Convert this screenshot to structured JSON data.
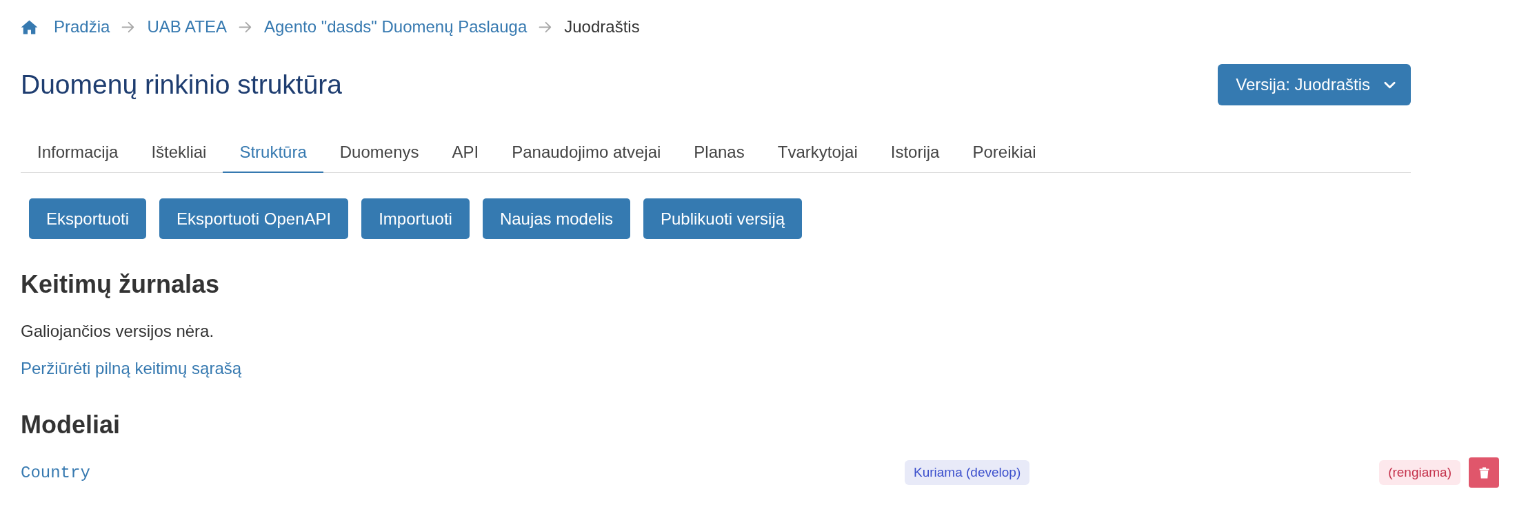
{
  "breadcrumb": [
    {
      "label": "Pradžia",
      "kind": "home"
    },
    {
      "label": "UAB ATEA",
      "kind": "link"
    },
    {
      "label": "Agento \"dasds\" Duomenų Paslauga",
      "kind": "link"
    },
    {
      "label": "Juodraštis",
      "kind": "current"
    }
  ],
  "page": {
    "title": "Duomenų rinkinio struktūra"
  },
  "version_button": {
    "label": "Versija: Juodraštis"
  },
  "tabs": [
    {
      "label": "Informacija",
      "selected": false
    },
    {
      "label": "Ištekliai",
      "selected": false
    },
    {
      "label": "Struktūra",
      "selected": true
    },
    {
      "label": "Duomenys",
      "selected": false
    },
    {
      "label": "API",
      "selected": false
    },
    {
      "label": "Panaudojimo atvejai",
      "selected": false
    },
    {
      "label": "Planas",
      "selected": false
    },
    {
      "label": "Tvarkytojai",
      "selected": false
    },
    {
      "label": "Istorija",
      "selected": false
    },
    {
      "label": "Poreikiai",
      "selected": false
    }
  ],
  "actions": [
    "Eksportuoti",
    "Eksportuoti OpenAPI",
    "Importuoti",
    "Naujas modelis",
    "Publikuoti versiją"
  ],
  "changelog": {
    "heading": "Keitimų žurnalas",
    "message": "Galiojančios versijos nėra.",
    "link": "Peržiūrėti pilną keitimų sąrašą"
  },
  "models": {
    "heading": "Modeliai",
    "rows": [
      {
        "name": "Country",
        "status": "Kuriama (develop)",
        "state": "(rengiama)"
      }
    ]
  }
}
